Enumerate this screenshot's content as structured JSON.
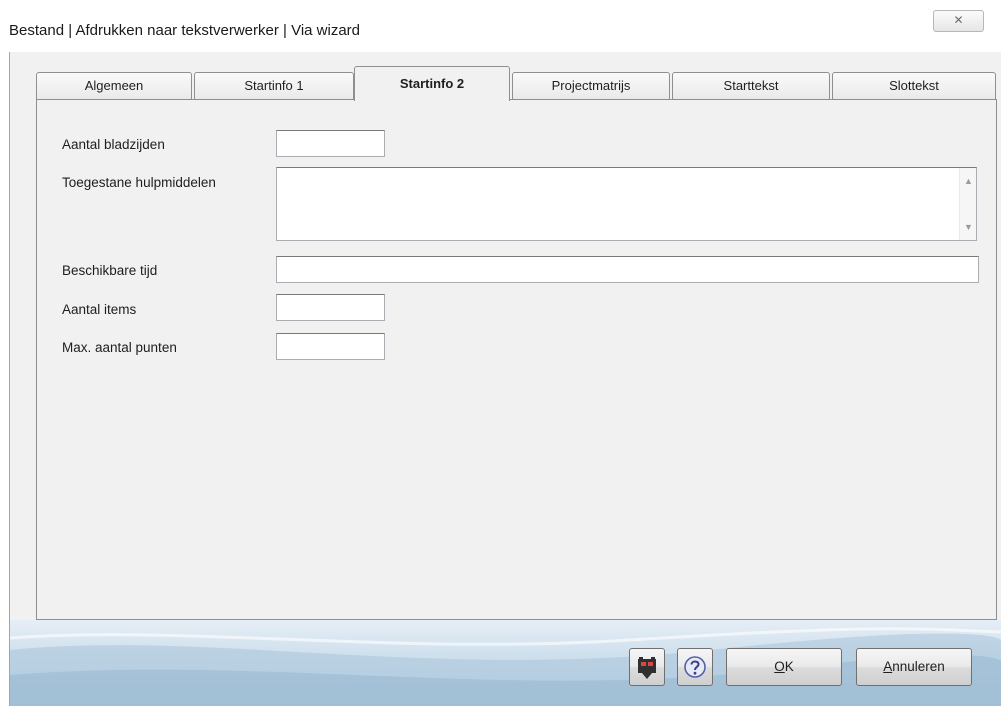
{
  "window": {
    "title": "Bestand | Afdrukken naar tekstverwerker | Via wizard",
    "close_glyph": "✕"
  },
  "tabs": [
    {
      "label": "Algemeen",
      "active": false
    },
    {
      "label": "Startinfo 1",
      "active": false
    },
    {
      "label": "Startinfo 2",
      "active": true
    },
    {
      "label": "Projectmatrijs",
      "active": false
    },
    {
      "label": "Starttekst",
      "active": false
    },
    {
      "label": "Slottekst",
      "active": false
    }
  ],
  "form": {
    "aantal_bladzijden": {
      "label": "Aantal bladzijden",
      "value": ""
    },
    "toegestane_hulpmiddelen": {
      "label": "Toegestane hulpmiddelen",
      "value": ""
    },
    "beschikbare_tijd": {
      "label": "Beschikbare tijd",
      "value": ""
    },
    "aantal_items": {
      "label": "Aantal items",
      "value": ""
    },
    "max_aantal_punten": {
      "label": "Max. aantal punten",
      "value": ""
    }
  },
  "buttons": {
    "ok_mnemonic": "O",
    "ok_rest": "K",
    "cancel_mnemonic": "A",
    "cancel_rest": "nnuleren"
  },
  "icons": {
    "film": "film-camera-icon",
    "help": "help-icon",
    "scroll_up": "▲",
    "scroll_down": "▼"
  },
  "colors": {
    "panel": "#f1f1f1",
    "border": "#8e8f8f",
    "footer_gradient": "#bcd3e5"
  }
}
